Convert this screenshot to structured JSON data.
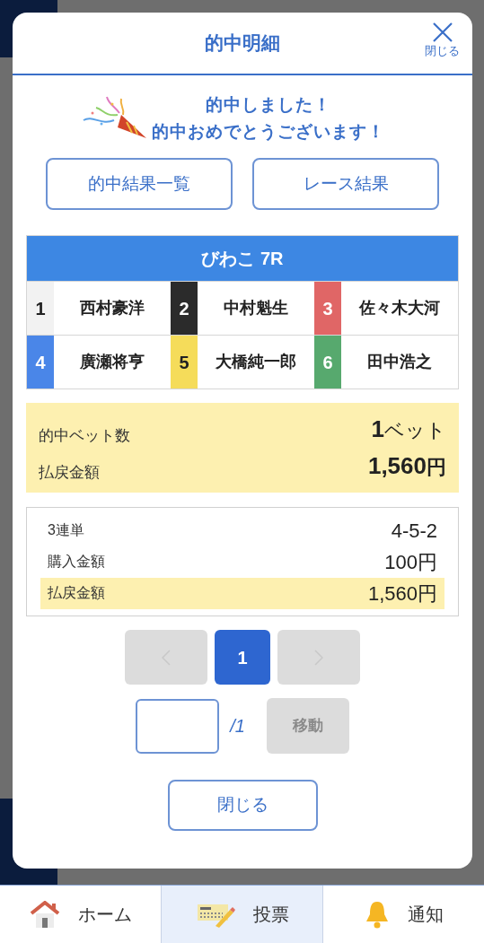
{
  "modal": {
    "title": "的中明細",
    "close_label": "閉じる",
    "message_lines": [
      "的中しました！",
      "的中おめでとうございます！"
    ],
    "links": [
      "的中結果一覧",
      "レース結果"
    ],
    "race": {
      "title": "びわこ 7R",
      "entries": [
        {
          "number": "1",
          "name": "西村豪洋",
          "color": "#f2f2f2"
        },
        {
          "number": "2",
          "name": "中村魁生",
          "color": "#2b2b2b"
        },
        {
          "number": "3",
          "name": "佐々木大河",
          "color": "#e06666"
        },
        {
          "number": "4",
          "name": "廣瀬将亨",
          "color": "#4a86e8"
        },
        {
          "number": "5",
          "name": "大橋純一郎",
          "color": "#f5dc5a"
        },
        {
          "number": "6",
          "name": "田中浩之",
          "color": "#57a96e"
        }
      ]
    },
    "summary": [
      {
        "label": "的中ベット数",
        "value_number": "1",
        "value_unit": "ベット"
      },
      {
        "label": "払戻金額",
        "value_number": "1,560",
        "value_unit": "円"
      }
    ],
    "details": [
      {
        "label": "3連単",
        "value": "4-5-2",
        "highlighted": false
      },
      {
        "label": "購入金額",
        "value": "100円",
        "highlighted": false
      },
      {
        "label": "払戻金額",
        "value": "1,560円",
        "highlighted": true
      }
    ],
    "pagination": {
      "prev_disabled": true,
      "next_disabled": true,
      "pages": [
        {
          "label": "1",
          "selected": true
        }
      ]
    },
    "jump": {
      "total": "/1",
      "button": "移動",
      "button_disabled": true
    },
    "close_button": "閉じる"
  },
  "bottom_nav": [
    {
      "label": "ホーム",
      "selected": false
    },
    {
      "label": "投票",
      "selected": true
    },
    {
      "label": "通知",
      "selected": false
    }
  ]
}
